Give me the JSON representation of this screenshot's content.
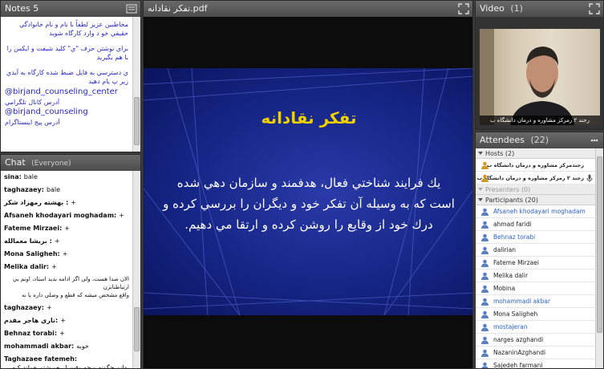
{
  "notes": {
    "title": "Notes",
    "count": "5",
    "para1": "مخاطبين عزيز لطفاً با نام و نام خانوادگي حقيقي خو د وارد كارگاه شويد",
    "para2": "براي نوشتن حرف \"ي\" كليد شيفت و ايكس را با هم بگيريد",
    "para3": "ي دسترسي به فايل ضبط شده كارگاه به آيدي زير پ يام دهيد",
    "link1": "@birjand_counseling_center",
    "link1_label": "آدرس كانال تلگرامي",
    "link2": "@birjand_counseling",
    "link2_label": "آدرس پيج اينستاگرام"
  },
  "chat": {
    "title": "Chat",
    "scope": "(Everyone)",
    "messages": [
      {
        "sender": "sina:",
        "text": "bale"
      },
      {
        "sender": "taghazaey:",
        "text": "bale"
      },
      {
        "sender": "بهشته رمهزاد شكر :",
        "text": "+"
      },
      {
        "sender": "Afsaneh khodayari moghadam:",
        "text": "+"
      },
      {
        "sender": "Fateme Mirzaei:",
        "text": "+"
      },
      {
        "sender": "بريشا معمالله :",
        "text": "+"
      },
      {
        "sender": "Mona Saligheh:",
        "text": "+"
      },
      {
        "sender": "Melika dalir:",
        "text": "+"
      },
      {
        "sender": "الان صدا هست، ولي اگر ادامه بديد استاد، اونم بي ارتباطنابزن",
        "text": "واقع مشخص ميشه كه قطع و وصلي داره يا نه"
      },
      {
        "sender": "taghazaey:",
        "text": "+"
      },
      {
        "sender": "ناري هاجر مقدم:",
        "text": "+"
      },
      {
        "sender": "Behnaz torabi:",
        "text": "+"
      },
      {
        "sender": "mohammadi akbar:",
        "text": "خوبه"
      },
      {
        "sender": "Taghazaee fatemeh:",
        "text": "بدانم چگونه و چه وقت از خويشتم خوانديكيه مرا فرا م ريبان"
      }
    ]
  },
  "presentation": {
    "filename": "تفكر نقادانه.pdf",
    "slide_title": "تفكر نقادانه",
    "slide_text": "يك فرايند شناختي فعال، هدفمند و سازمان دهي شده است كه به وسيله آن تفكر خود و ديگران را بررسي كرده و درك خود از وقايع را روشن كرده و ارتقا مي دهيم."
  },
  "video": {
    "title": "Video",
    "count": "(1)",
    "caption": "رجند ۲ رمركز مشاوره و درمان دانشگاه ب"
  },
  "attendees": {
    "title": "Attendees",
    "count": "(22)",
    "hosts_label": "Hosts (2)",
    "hosts": [
      "رجندمركز مشاوره و درمان دانشگاه ب",
      "رجند ۲ رمركز مشاوره و درمان دانشگاه ب"
    ],
    "presenters_label": "Presenters (0)",
    "participants_label": "Participants (20)",
    "participants": [
      {
        "name": "Afsaneh khodayari moghadam",
        "blue": true
      },
      {
        "name": "ahmad faridi",
        "blue": false
      },
      {
        "name": "Behnaz torabi",
        "blue": true
      },
      {
        "name": "dalirian",
        "blue": false
      },
      {
        "name": "Fateme Mirzaei",
        "blue": false
      },
      {
        "name": "Melika dalir",
        "blue": false
      },
      {
        "name": "Mobina",
        "blue": false
      },
      {
        "name": "mohammadi akbar",
        "blue": true
      },
      {
        "name": "Mona Saligheh",
        "blue": false
      },
      {
        "name": "mostajeran",
        "blue": true
      },
      {
        "name": "narges azghandi",
        "blue": false
      },
      {
        "name": "NazaninAzghandi",
        "blue": false
      },
      {
        "name": "Sajedeh farmani",
        "blue": false
      }
    ]
  },
  "colors": {
    "slide_title": "#f0d000",
    "link_text": "#2626c8",
    "participant_blue": "#2b5fd0"
  }
}
